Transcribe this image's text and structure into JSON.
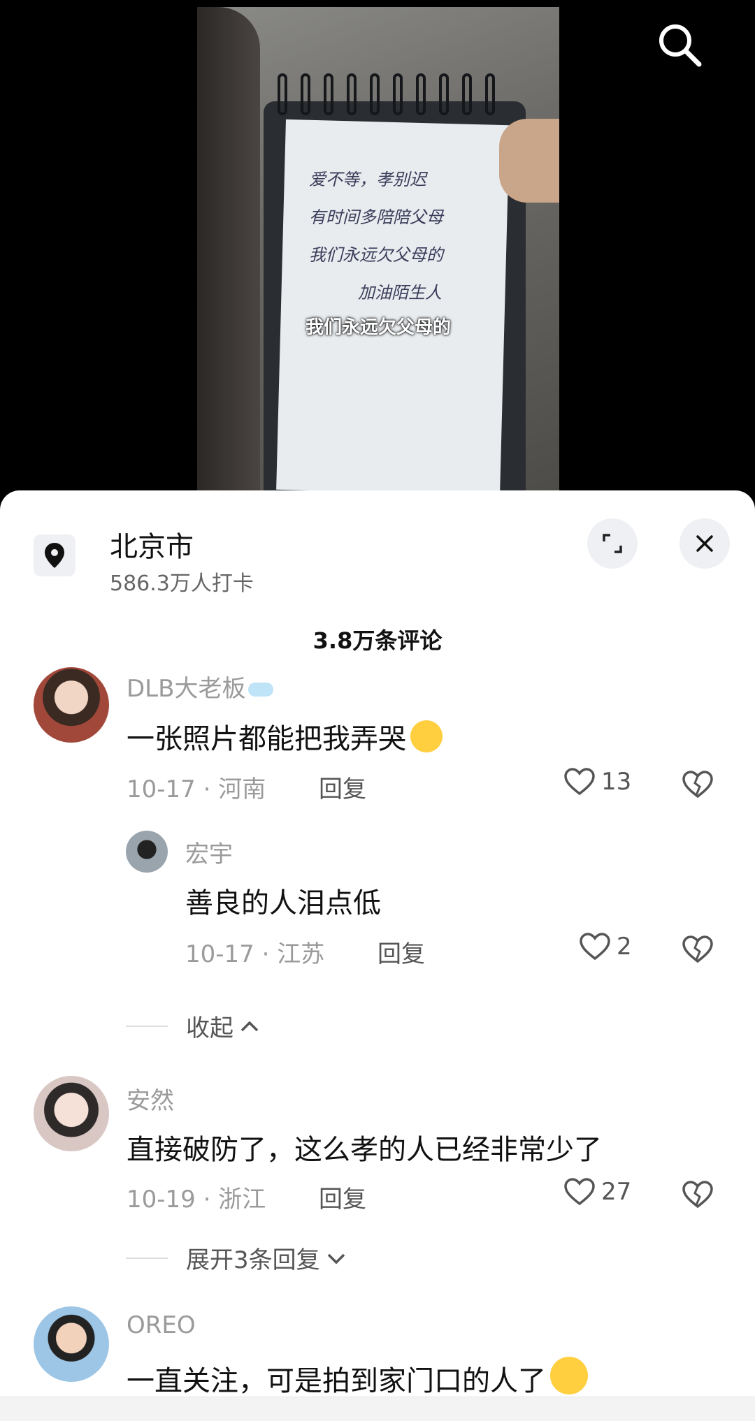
{
  "video": {
    "handwriting": [
      "爱不等，孝别迟",
      "有时间多陪陪父母",
      "我们永远欠父母的",
      "加油陌生人"
    ],
    "subtitle": "我们永远欠父母的",
    "search_icon": "search-icon"
  },
  "location": {
    "title": "北京市",
    "subtitle": "586.3万人打卡"
  },
  "comments_header": "3.8万条评论",
  "comments": [
    {
      "user": "DLB大老板",
      "text": "一张照片都能把我弄哭",
      "date": "10-17",
      "region": "河南",
      "reply_label": "回复",
      "likes": "13"
    },
    {
      "user": "安然",
      "text": "直接破防了，这么孝的人已经非常少了",
      "date": "10-19",
      "region": "浙江",
      "reply_label": "回复",
      "likes": "27"
    },
    {
      "user": "OREO",
      "text": "一直关注，可是拍到家门口的人了"
    }
  ],
  "reply": {
    "user": "宏宇",
    "text": "善良的人泪点低",
    "date": "10-17",
    "region": "江苏",
    "reply_label": "回复",
    "likes": "2"
  },
  "collapse_label": "收起",
  "expand_label": "展开3条回复",
  "dot": "·",
  "colors": {
    "sheet": "#ffffff",
    "muted": "#9a9a9a",
    "text": "#111111"
  }
}
